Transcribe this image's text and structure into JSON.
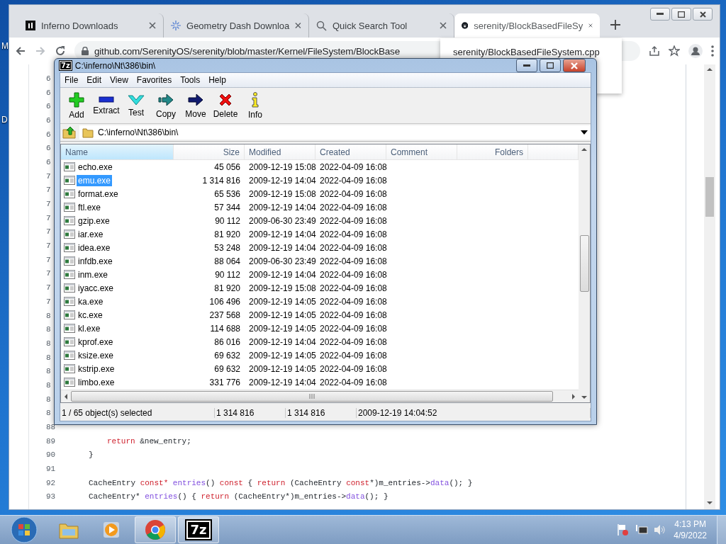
{
  "desktop": {
    "icon_labels": [
      "M",
      "D"
    ]
  },
  "browser": {
    "tabs": [
      {
        "title": "Inferno Downloads",
        "kind": "logo",
        "selected": false
      },
      {
        "title": "Geometry Dash Downloa",
        "kind": "sparkle",
        "selected": false
      },
      {
        "title": "Quick Search Tool",
        "kind": "search",
        "selected": false
      },
      {
        "title": "serenity/BlockBasedFileSy",
        "kind": "cat",
        "selected": true
      }
    ],
    "address": "github.com/SerenityOS/serenity/blob/master/Kernel/FileSystem/BlockBase",
    "link_preview": "serenity/BlockBasedFileSystem.cpp",
    "code_lines": [
      {
        "number": "6"
      },
      {
        "number": "6"
      },
      {
        "number": "6"
      },
      {
        "number": "6"
      },
      {
        "number": "6"
      },
      {
        "number": "6"
      },
      {
        "number": "6"
      },
      {
        "number": "7"
      },
      {
        "number": "7"
      },
      {
        "number": "7"
      },
      {
        "number": "7"
      },
      {
        "number": "7"
      },
      {
        "number": "7"
      },
      {
        "number": "7"
      },
      {
        "number": "7"
      },
      {
        "number": "7"
      },
      {
        "number": "7"
      },
      {
        "number": "8"
      },
      {
        "number": "8"
      },
      {
        "number": "8"
      },
      {
        "number": "8"
      },
      {
        "number": "8"
      },
      {
        "number": "8"
      },
      {
        "number": "8"
      },
      {
        "number": "8"
      },
      {
        "number": "88"
      },
      {
        "number": "89",
        "indent": true,
        "tokens": [
          {
            "text": "return",
            "kind": "keyword"
          },
          {
            "text": " &new_entry;",
            "kind": "plain"
          }
        ]
      },
      {
        "number": "90",
        "tokens": [
          {
            "text": "}",
            "kind": "plain"
          }
        ]
      },
      {
        "number": "91"
      },
      {
        "number": "92",
        "tokens": [
          {
            "text": "CacheEntry ",
            "kind": "plain"
          },
          {
            "text": "const*",
            "kind": "keyword"
          },
          {
            "text": " entries",
            "kind": "function"
          },
          {
            "text": "() ",
            "kind": "plain"
          },
          {
            "text": "const",
            "kind": "keyword"
          },
          {
            "text": " { ",
            "kind": "plain"
          },
          {
            "text": "return",
            "kind": "keyword"
          },
          {
            "text": " (CacheEntry ",
            "kind": "plain"
          },
          {
            "text": "const",
            "kind": "keyword"
          },
          {
            "text": "*)m_entries->",
            "kind": "plain"
          },
          {
            "text": "data",
            "kind": "function"
          },
          {
            "text": "(); }",
            "kind": "plain"
          }
        ]
      },
      {
        "number": "93",
        "tokens": [
          {
            "text": "CacheEntry* ",
            "kind": "plain"
          },
          {
            "text": "entries",
            "kind": "function"
          },
          {
            "text": "() { ",
            "kind": "plain"
          },
          {
            "text": "return",
            "kind": "keyword"
          },
          {
            "text": " (CacheEntry*)m_entries->",
            "kind": "plain"
          },
          {
            "text": "data",
            "kind": "function"
          },
          {
            "text": "(); }",
            "kind": "plain"
          }
        ]
      }
    ]
  },
  "archiver": {
    "logo_text": "7z",
    "title": "C:\\inferno\\Nt\\386\\bin\\",
    "menu": [
      "File",
      "Edit",
      "View",
      "Favorites",
      "Tools",
      "Help"
    ],
    "toolbar": [
      {
        "label": "Add",
        "kind": "add"
      },
      {
        "label": "Extract",
        "kind": "extract"
      },
      {
        "label": "Test",
        "kind": "test"
      },
      {
        "label": "Copy",
        "kind": "copy"
      },
      {
        "label": "Move",
        "kind": "move"
      },
      {
        "label": "Delete",
        "kind": "delete"
      },
      {
        "label": "Info",
        "kind": "info"
      }
    ],
    "path": "C:\\inferno\\Nt\\386\\bin\\",
    "columns": [
      {
        "label": "Name",
        "selected": true
      },
      {
        "label": "Size",
        "selected": false
      },
      {
        "label": "Modified",
        "selected": false
      },
      {
        "label": "Created",
        "selected": false
      },
      {
        "label": "Comment",
        "selected": false
      },
      {
        "label": "Folders",
        "selected": false
      }
    ],
    "rows": [
      {
        "name": "echo.exe",
        "size": "45 056",
        "modified": "2009-12-19 15:08",
        "created": "2022-04-09 16:08",
        "selected": false
      },
      {
        "name": "emu.exe",
        "size": "1 314 816",
        "modified": "2009-12-19 14:04",
        "created": "2022-04-09 16:08",
        "selected": true
      },
      {
        "name": "format.exe",
        "size": "65 536",
        "modified": "2009-12-19 15:08",
        "created": "2022-04-09 16:08",
        "selected": false
      },
      {
        "name": "ftl.exe",
        "size": "57 344",
        "modified": "2009-12-19 14:04",
        "created": "2022-04-09 16:08",
        "selected": false
      },
      {
        "name": "gzip.exe",
        "size": "90 112",
        "modified": "2009-06-30 23:49",
        "created": "2022-04-09 16:08",
        "selected": false
      },
      {
        "name": "iar.exe",
        "size": "81 920",
        "modified": "2009-12-19 14:04",
        "created": "2022-04-09 16:08",
        "selected": false
      },
      {
        "name": "idea.exe",
        "size": "53 248",
        "modified": "2009-12-19 14:04",
        "created": "2022-04-09 16:08",
        "selected": false
      },
      {
        "name": "infdb.exe",
        "size": "88 064",
        "modified": "2009-06-30 23:49",
        "created": "2022-04-09 16:08",
        "selected": false
      },
      {
        "name": "inm.exe",
        "size": "90 112",
        "modified": "2009-12-19 14:04",
        "created": "2022-04-09 16:08",
        "selected": false
      },
      {
        "name": "iyacc.exe",
        "size": "81 920",
        "modified": "2009-12-19 15:08",
        "created": "2022-04-09 16:08",
        "selected": false
      },
      {
        "name": "ka.exe",
        "size": "106 496",
        "modified": "2009-12-19 14:05",
        "created": "2022-04-09 16:08",
        "selected": false
      },
      {
        "name": "kc.exe",
        "size": "237 568",
        "modified": "2009-12-19 14:05",
        "created": "2022-04-09 16:08",
        "selected": false
      },
      {
        "name": "kl.exe",
        "size": "114 688",
        "modified": "2009-12-19 14:05",
        "created": "2022-04-09 16:08",
        "selected": false
      },
      {
        "name": "kprof.exe",
        "size": "86 016",
        "modified": "2009-12-19 14:04",
        "created": "2022-04-09 16:08",
        "selected": false
      },
      {
        "name": "ksize.exe",
        "size": "69 632",
        "modified": "2009-12-19 14:05",
        "created": "2022-04-09 16:08",
        "selected": false
      },
      {
        "name": "kstrip.exe",
        "size": "69 632",
        "modified": "2009-12-19 14:05",
        "created": "2022-04-09 16:08",
        "selected": false
      },
      {
        "name": "limbo.exe",
        "size": "331 776",
        "modified": "2009-12-19 14:04",
        "created": "2022-04-09 16:08",
        "selected": false
      }
    ],
    "status": [
      "1 / 65 object(s) selected",
      "1 314 816",
      "1 314 816",
      "2009-12-19 14:04:52"
    ]
  },
  "taskbar": {
    "apps": [
      {
        "kind": "folder",
        "running": false
      },
      {
        "kind": "media",
        "running": false
      },
      {
        "kind": "browser",
        "running": true
      },
      {
        "kind": "archiver",
        "running": true
      }
    ],
    "logo_text": "7z",
    "time": "4:13 PM",
    "date": "4/9/2022"
  }
}
